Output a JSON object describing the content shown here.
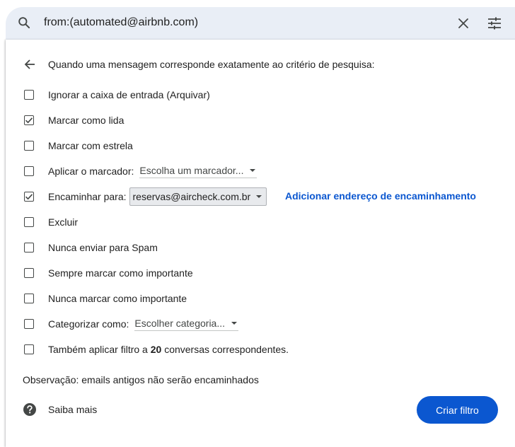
{
  "search": {
    "query": "from:(automated@airbnb.com)",
    "search_icon": "search-icon",
    "clear_icon": "close-icon",
    "options_icon": "tune-icon"
  },
  "panel": {
    "back_icon": "arrow-back-icon",
    "heading": "Quando uma mensagem corresponde exatamente ao critério de pesquisa:",
    "options": [
      {
        "label": "Ignorar a caixa de entrada (Arquivar)",
        "checked": false
      },
      {
        "label": "Marcar como lida",
        "checked": true
      },
      {
        "label": "Marcar com estrela",
        "checked": false
      },
      {
        "label": "Aplicar o marcador:",
        "checked": false,
        "dropdown": "Escolha um marcador..."
      },
      {
        "label": "Encaminhar para:",
        "checked": true,
        "dropdown": "reservas@aircheck.com.br",
        "link": "Adicionar endereço de encaminhamento"
      },
      {
        "label": "Excluir",
        "checked": false
      },
      {
        "label": "Nunca enviar para Spam",
        "checked": false
      },
      {
        "label": "Sempre marcar como importante",
        "checked": false
      },
      {
        "label": "Nunca marcar como importante",
        "checked": false
      },
      {
        "label": "Categorizar como:",
        "checked": false,
        "dropdown": "Escolher categoria..."
      },
      {
        "label_prefix": "Também aplicar filtro a",
        "count": "20",
        "label_suffix": "conversas correspondentes.",
        "checked": false
      }
    ],
    "note": "Observação: emails antigos não serão encaminhados",
    "learn_more": "Saiba mais",
    "help_icon": "help-icon",
    "create_button": "Criar filtro"
  },
  "colors": {
    "accent": "#0b57d0",
    "search_bg": "#e9eef6",
    "text": "#1f1f1f",
    "dropdown_bg": "#e8eaed"
  }
}
